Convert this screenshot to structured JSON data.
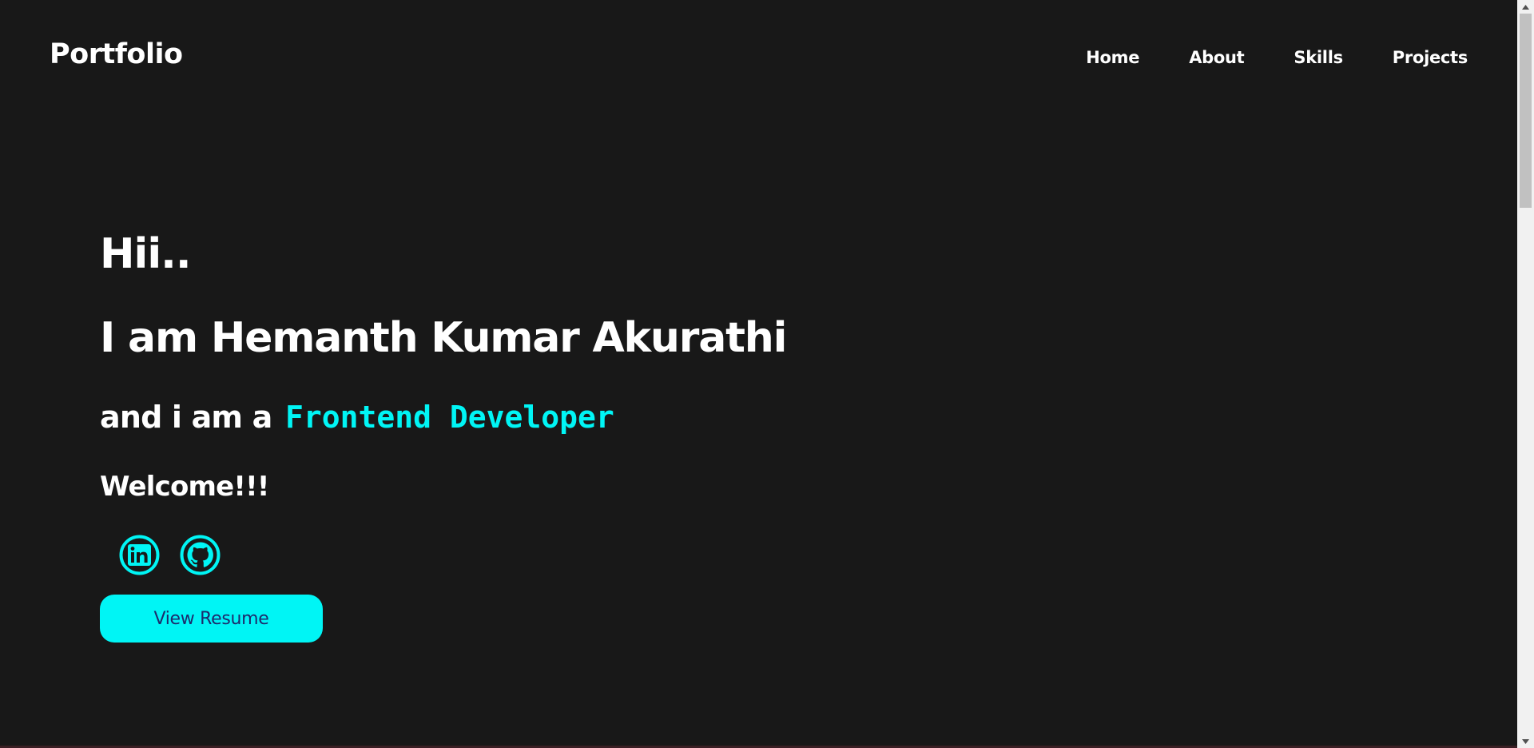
{
  "navbar": {
    "brand": "Portfolio",
    "links": [
      {
        "label": "Home"
      },
      {
        "label": "About"
      },
      {
        "label": "Skills"
      },
      {
        "label": "Projects"
      }
    ]
  },
  "hero": {
    "greeting": "Hii..",
    "intro": "I am Hemanth Kumar Akurathi",
    "role_prefix": "and i am a",
    "role": "Frontend Developer",
    "welcome": "Welcome!!!",
    "socials": [
      {
        "icon": "linkedin-icon"
      },
      {
        "icon": "github-icon"
      }
    ],
    "resume_button": "View Resume"
  },
  "colors": {
    "background": "#181818",
    "accent": "#00f5f5",
    "button_text": "#1d2a6b",
    "text": "#ffffff"
  }
}
